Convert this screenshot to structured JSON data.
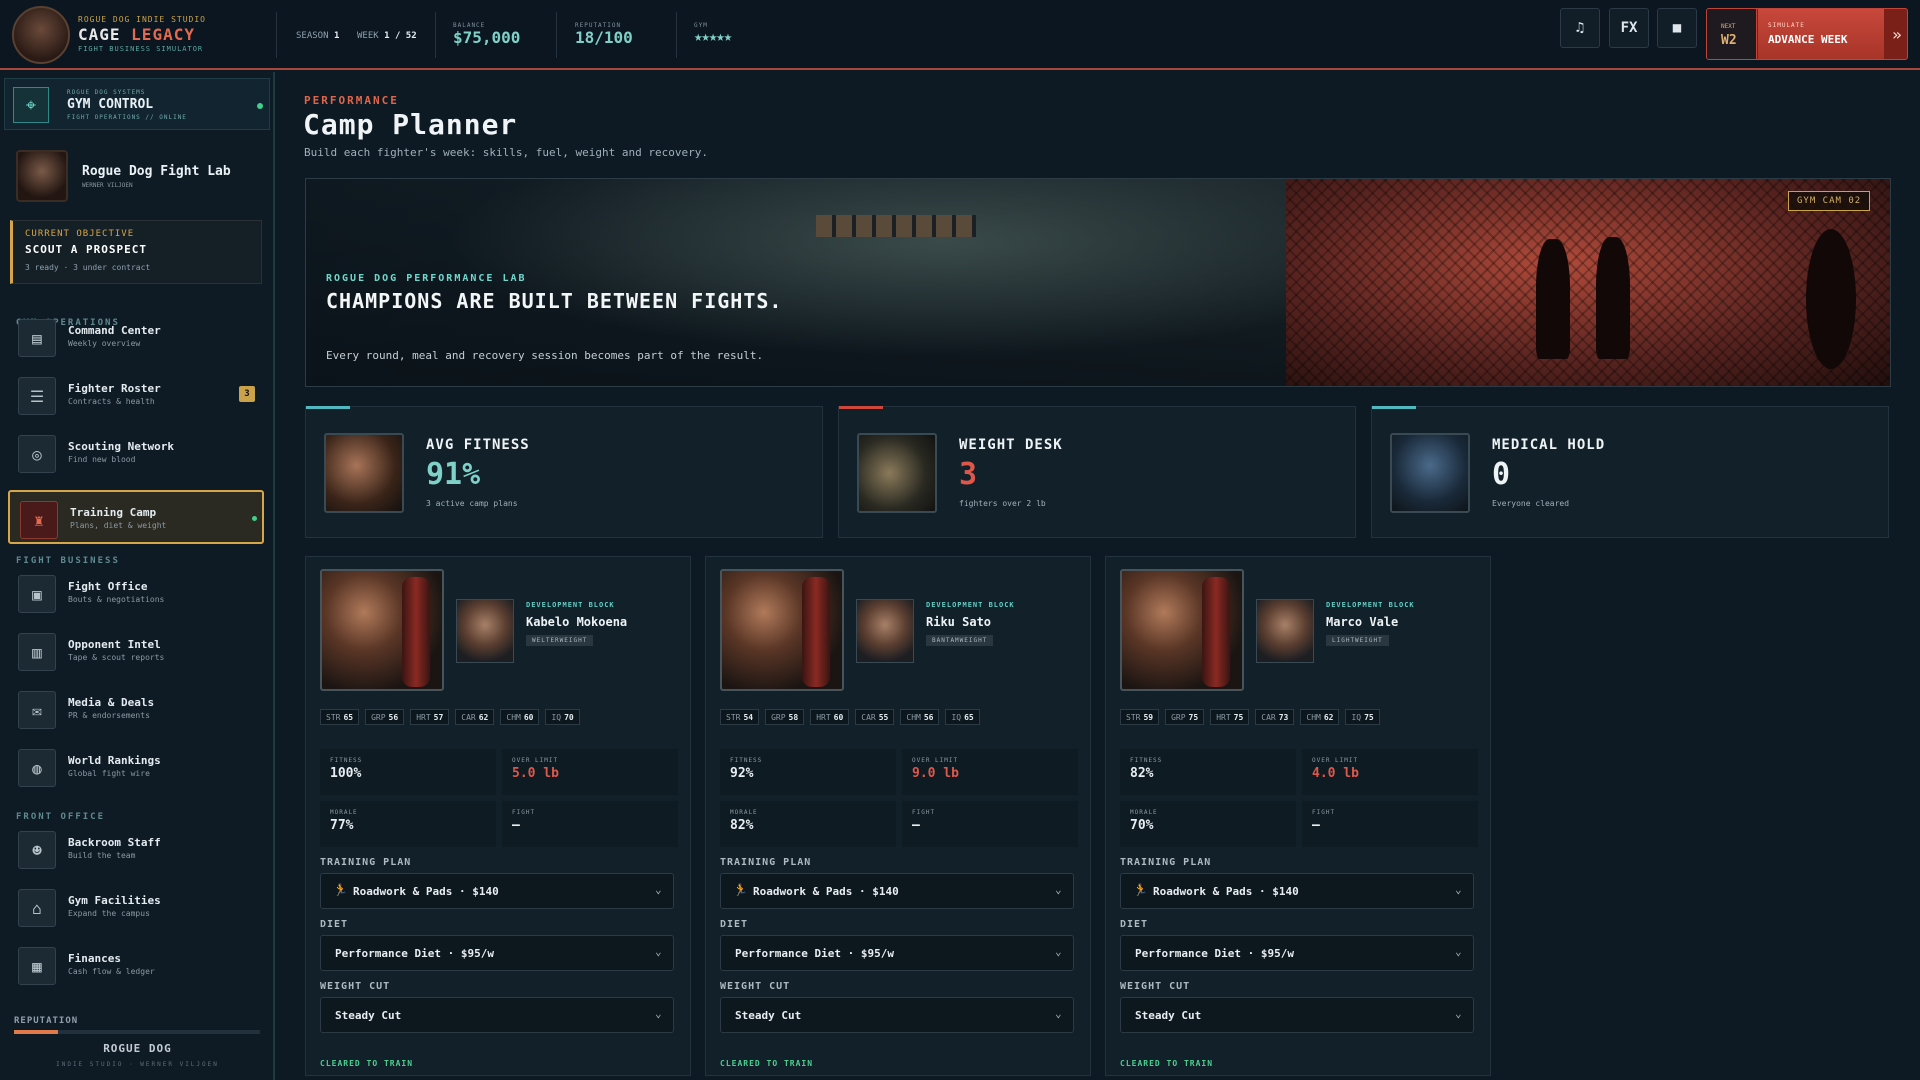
{
  "topbar": {
    "studio_small": "ROGUE DOG INDIE STUDIO",
    "title_main": "CAGE",
    "title_accent": "LEGACY",
    "subtitle": "FIGHT BUSINESS SIMULATOR",
    "season_label": "SEASON",
    "season_value": "1",
    "week_label": "WEEK",
    "week_value": "1 / 52",
    "balance_label": "BALANCE",
    "balance_value": "$75,000",
    "reputation_label": "REPUTATION",
    "reputation_value": "18/100",
    "gym_label": "GYM",
    "gym_stars": "★★★★★",
    "music_icon": "♫",
    "fx_label": "FX",
    "stop_icon": "■",
    "next_label": "NEXT",
    "next_value": "W2",
    "simulate_label": "SIMULATE",
    "advance_label": "ADVANCE WEEK",
    "advance_icon": "»"
  },
  "sidebar": {
    "gym_control": {
      "small": "ROGUE DOG SYSTEMS",
      "title": "GYM CONTROL",
      "sub": "FIGHT OPERATIONS // ONLINE",
      "icon": "⌖"
    },
    "lab": {
      "name": "Rogue Dog Fight Lab",
      "sub": "WERNER VILJOEN"
    },
    "objective": {
      "small": "CURRENT OBJECTIVE",
      "title": "SCOUT A PROSPECT",
      "sub": "3 ready · 3 under contract"
    },
    "sections": [
      "GYM OPERATIONS",
      "FIGHT BUSINESS",
      "FRONT OFFICE"
    ],
    "gym_ops": [
      {
        "name": "Command Center",
        "sub": "Weekly overview",
        "icon": "▤"
      },
      {
        "name": "Fighter Roster",
        "sub": "Contracts & health",
        "icon": "☰",
        "badge": "3"
      },
      {
        "name": "Scouting Network",
        "sub": "Find new blood",
        "icon": "◎"
      },
      {
        "name": "Training Camp",
        "sub": "Plans, diet & weight",
        "icon": "♜"
      }
    ],
    "fight_business": [
      {
        "name": "Fight Office",
        "sub": "Bouts & negotiations",
        "icon": "▣"
      },
      {
        "name": "Opponent Intel",
        "sub": "Tape & scout reports",
        "icon": "▥"
      },
      {
        "name": "Media & Deals",
        "sub": "PR & endorsements",
        "icon": "✉"
      },
      {
        "name": "World Rankings",
        "sub": "Global fight wire",
        "icon": "◍"
      }
    ],
    "front_office": [
      {
        "name": "Backroom Staff",
        "sub": "Build the team",
        "icon": "☻"
      },
      {
        "name": "Gym Facilities",
        "sub": "Expand the campus",
        "icon": "⌂"
      },
      {
        "name": "Finances",
        "sub": "Cash flow & ledger",
        "icon": "▦"
      }
    ],
    "reputation_label": "REPUTATION",
    "reputation_fraction": 0.18,
    "bottom_title": "ROGUE DOG",
    "bottom_sub": "INDIE STUDIO · WERNER VILJOEN"
  },
  "page": {
    "small": "PERFORMANCE",
    "title": "Camp Planner",
    "subtitle": "Build each fighter's week: skills, fuel, weight and recovery."
  },
  "hero": {
    "small": "ROGUE DOG PERFORMANCE LAB",
    "headline": "CHAMPIONS ARE BUILT BETWEEN FIGHTS.",
    "sub": "Every round, meal and recovery session becomes part of the result.",
    "cam_tag": "GYM CAM 02"
  },
  "stats": [
    {
      "label": "AVG FITNESS",
      "value": "91%",
      "sub": "3 active camp plans",
      "color": "#7fd1c8"
    },
    {
      "label": "WEIGHT DESK",
      "value": "3",
      "sub": "fighters over 2 lb",
      "color": "#e0574a"
    },
    {
      "label": "MEDICAL HOLD",
      "value": "0",
      "sub": "Everyone cleared",
      "color": "#eef3f5"
    }
  ],
  "fighter_labels": {
    "dev_block": "DEVELOPMENT BLOCK",
    "fitness": "FITNESS",
    "over_limit": "OVER LIMIT",
    "morale": "MORALE",
    "fight": "FIGHT",
    "training_plan": "TRAINING PLAN",
    "diet": "DIET",
    "weight_cut": "WEIGHT CUT",
    "cleared": "CLEARED TO TRAIN",
    "chevron": "⌄",
    "plan_icon": "🏃"
  },
  "fighters": [
    {
      "name": "Kabelo Mokoena",
      "weight_class": "WELTERWEIGHT",
      "attrs": [
        [
          "STR",
          "65"
        ],
        [
          "GRP",
          "56"
        ],
        [
          "HRT",
          "57"
        ],
        [
          "CAR",
          "62"
        ],
        [
          "CHM",
          "60"
        ],
        [
          "IQ",
          "70"
        ]
      ],
      "fitness": "100%",
      "over_limit": "5.0 lb",
      "morale": "77%",
      "fight": "—",
      "plan": "Roadwork & Pads · $140",
      "diet": "Performance Diet · $95/w",
      "cut": "Steady Cut"
    },
    {
      "name": "Riku Sato",
      "weight_class": "BANTAMWEIGHT",
      "attrs": [
        [
          "STR",
          "54"
        ],
        [
          "GRP",
          "58"
        ],
        [
          "HRT",
          "60"
        ],
        [
          "CAR",
          "55"
        ],
        [
          "CHM",
          "56"
        ],
        [
          "IQ",
          "65"
        ]
      ],
      "fitness": "92%",
      "over_limit": "9.0 lb",
      "morale": "82%",
      "fight": "—",
      "plan": "Roadwork & Pads · $140",
      "diet": "Performance Diet · $95/w",
      "cut": "Steady Cut"
    },
    {
      "name": "Marco Vale",
      "weight_class": "LIGHTWEIGHT",
      "attrs": [
        [
          "STR",
          "59"
        ],
        [
          "GRP",
          "75"
        ],
        [
          "HRT",
          "75"
        ],
        [
          "CAR",
          "73"
        ],
        [
          "CHM",
          "62"
        ],
        [
          "IQ",
          "75"
        ]
      ],
      "fitness": "82%",
      "over_limit": "4.0 lb",
      "morale": "70%",
      "fight": "—",
      "plan": "Roadwork & Pads · $140",
      "diet": "Performance Diet · $95/w",
      "cut": "Steady Cut"
    }
  ]
}
